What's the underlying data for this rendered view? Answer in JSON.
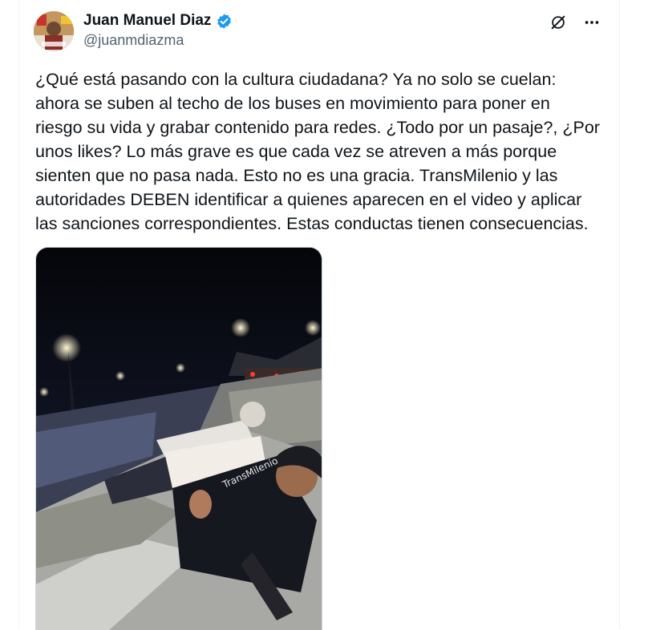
{
  "author": {
    "display_name": "Juan Manuel Diaz",
    "handle": "@juanmdiazma",
    "verified_icon": "verified-badge-icon",
    "avatar_icon": "avatar"
  },
  "header_actions": {
    "grok_icon": "grok-icon",
    "more_icon": "more-icon"
  },
  "tweet": {
    "text": "¿Qué está pasando con la cultura ciudadana? Ya no solo se cuelan:\nahora se suben al techo de los buses en movimiento para poner en\nriesgo su vida y grabar contenido para redes. ¿Todo por un pasaje?, ¿Por\nunos likes? Lo más grave es que cada vez se atreven a más porque\nsienten que no pasa nada. Esto no es una gracia. TransMilenio y las\nautoridades DEBEN identificar a quienes aparecen en el video y aplicar\nlas sanciones correspondientes. Estas conductas tienen consecuencias."
  },
  "media": {
    "kind": "video",
    "scene": "night-bus-roof",
    "shirt_text": "TransMilenio"
  },
  "colors": {
    "accent": "#1d9bf0",
    "text": "#0f1419",
    "secondary": "#536471",
    "border": "#cfd9de"
  }
}
